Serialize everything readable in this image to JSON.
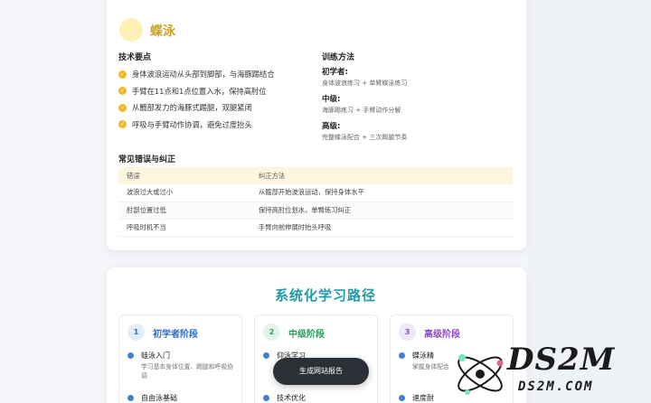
{
  "stroke": {
    "name": "蝶泳",
    "tech_heading": "技术要点",
    "tech_points": [
      "身体波浪运动从头部到脚部，与海豚踢结合",
      "手臂在11点和1点位置入水，保持高肘位",
      "从髋部发力的海豚式踢腿，双腿紧闭",
      "呼吸与手臂动作协调，避免过度抬头"
    ],
    "method_heading": "训练方法",
    "methods": [
      {
        "level": "初学者:",
        "desc": "身体波浪练习 + 单臂蝶泳练习"
      },
      {
        "level": "中级:",
        "desc": "海豚踢练习 + 手臂动作分解"
      },
      {
        "level": "高级:",
        "desc": "完整蝶泳配合 + 三次踢腿节奏"
      }
    ],
    "errors_heading": "常见错误与纠正",
    "errors_columns": [
      "错误",
      "纠正方法"
    ],
    "errors": [
      [
        "波浪过大或过小",
        "从髋部开始波浪运动，保持身体水平"
      ],
      [
        "肘部位置过低",
        "保持高肘位划水，单臂练习纠正"
      ],
      [
        "呼吸时机不当",
        "手臂向前伸展时抬头呼吸"
      ]
    ]
  },
  "learning_path": {
    "title": "系统化学习路径",
    "stages": [
      {
        "num": "1",
        "name": "初学者阶段",
        "items": [
          {
            "name": "蛙泳入门",
            "desc": "学习基本身体位置、踢腿和呼吸协调"
          },
          {
            "name": "自由泳基础",
            "desc": ""
          }
        ]
      },
      {
        "num": "2",
        "name": "中级阶段",
        "items": [
          {
            "name": "仰泳学习",
            "desc": ""
          },
          {
            "name": "技术优化",
            "desc": ""
          }
        ]
      },
      {
        "num": "3",
        "name": "高级阶段",
        "items": [
          {
            "name": "蝶泳精",
            "desc": "掌握身体配合"
          },
          {
            "name": "速度耐",
            "desc": ""
          }
        ]
      }
    ]
  },
  "report_button": "生成网站报告",
  "watermark": {
    "logo_text": "DS2M",
    "sub_text": "DS2M.COM"
  },
  "colors": {
    "accent_teal": "#1f9aa8",
    "check_yellow": "#f2b824",
    "stroke_gold": "#c9a227"
  }
}
